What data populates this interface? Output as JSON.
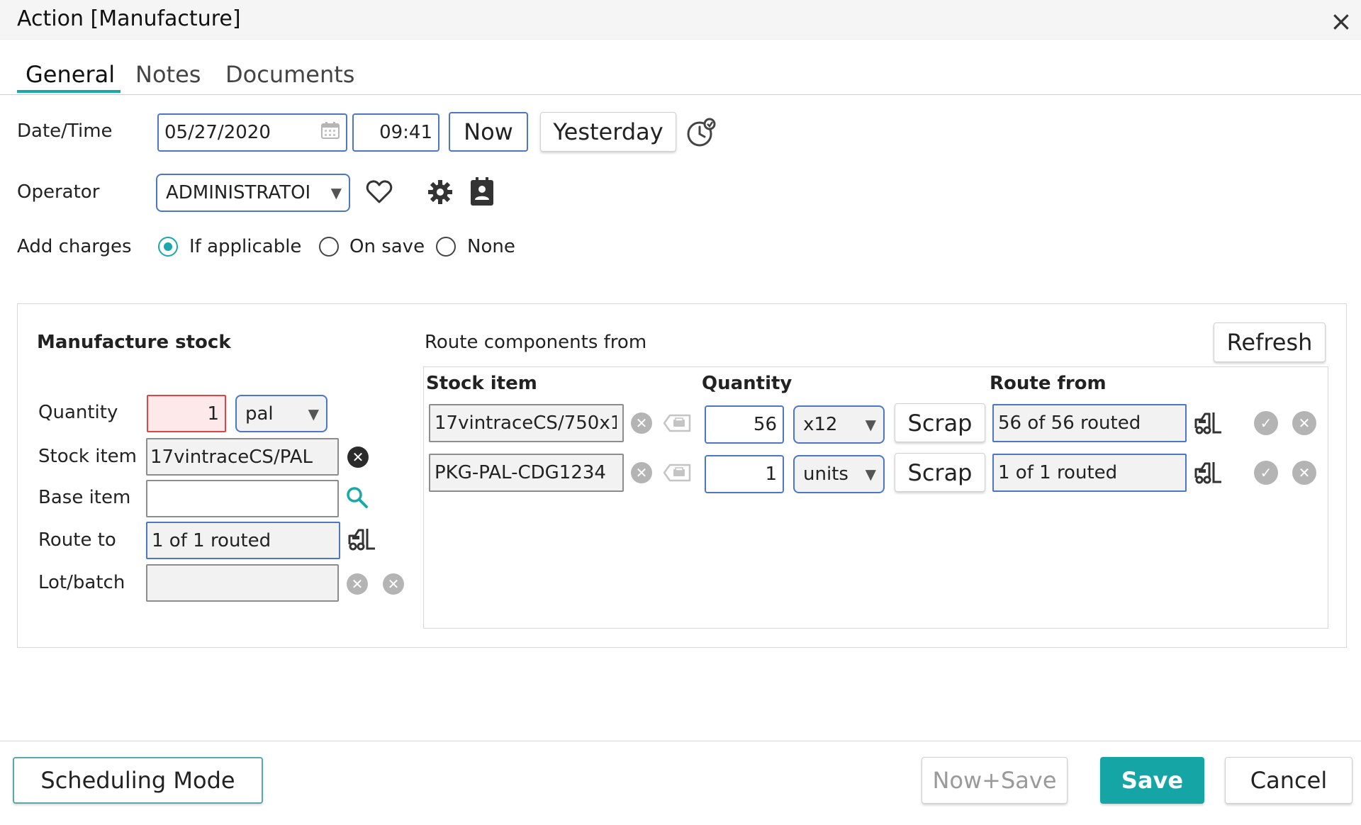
{
  "window": {
    "title": "Action [Manufacture]"
  },
  "tabs": [
    {
      "label": "General",
      "active": true
    },
    {
      "label": "Notes",
      "active": false
    },
    {
      "label": "Documents",
      "active": false
    }
  ],
  "datetime": {
    "label": "Date/Time",
    "date_value": "05/27/2020",
    "time_value": "09:41",
    "now_label": "Now",
    "yesterday_label": "Yesterday"
  },
  "operator": {
    "label": "Operator",
    "value": "ADMINISTRATOI"
  },
  "charges": {
    "label": "Add charges",
    "options": [
      {
        "label": "If applicable",
        "checked": true
      },
      {
        "label": "On save",
        "checked": false
      },
      {
        "label": "None",
        "checked": false
      }
    ]
  },
  "manufacture": {
    "heading": "Manufacture stock",
    "quantity_label": "Quantity",
    "quantity_value": "1",
    "unit_value": "pal",
    "stock_item_label": "Stock item",
    "stock_item_value": "17vintraceCS/PAL",
    "base_item_label": "Base item",
    "base_item_value": "",
    "route_to_label": "Route to",
    "route_to_value": "1 of 1 routed",
    "lot_label": "Lot/batch",
    "lot_value": ""
  },
  "route": {
    "heading": "Route components from",
    "refresh_label": "Refresh",
    "columns": {
      "stock_item": "Stock item",
      "quantity": "Quantity",
      "route_from": "Route from"
    },
    "rows": [
      {
        "stock_item": "17vintraceCS/750x1",
        "quantity": "56",
        "unit": "x12",
        "scrap_label": "Scrap",
        "route_from": "56 of 56 routed"
      },
      {
        "stock_item": "PKG-PAL-CDG1234",
        "quantity": "1",
        "unit": "units",
        "scrap_label": "Scrap",
        "route_from": "1 of 1 routed"
      }
    ]
  },
  "footer": {
    "scheduling_label": "Scheduling Mode",
    "now_save_label": "Now+Save",
    "save_label": "Save",
    "cancel_label": "Cancel"
  },
  "colors": {
    "accent": "#16a5a5",
    "input_border": "#4d77c4",
    "error_border": "#e04545"
  },
  "icons": [
    "close-icon",
    "calendar-icon",
    "clock-history-icon",
    "heart-icon",
    "gear-icon",
    "contact-card-icon",
    "search-icon",
    "forklift-icon",
    "clear-icon",
    "print-icon",
    "check-icon"
  ]
}
